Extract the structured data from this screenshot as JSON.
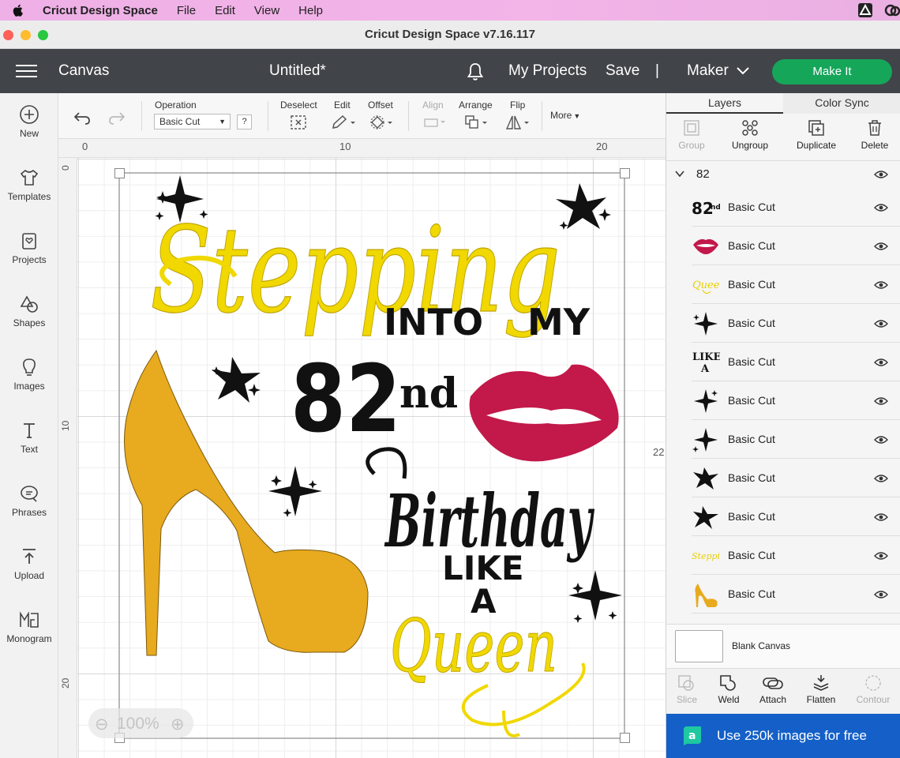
{
  "menubar": {
    "app_name": "Cricut Design Space",
    "menus": [
      "File",
      "Edit",
      "View",
      "Help"
    ]
  },
  "window": {
    "title": "Cricut Design Space  v7.16.117"
  },
  "header": {
    "canvas_label": "Canvas",
    "doc_title": "Untitled*",
    "my_projects": "My Projects",
    "save": "Save",
    "separator": "|",
    "machine": "Maker",
    "make_it": "Make It"
  },
  "left_tools": [
    {
      "label": "New",
      "icon": "plus-circle-icon"
    },
    {
      "label": "Templates",
      "icon": "shirt-icon"
    },
    {
      "label": "Projects",
      "icon": "projects-icon"
    },
    {
      "label": "Shapes",
      "icon": "shapes-icon"
    },
    {
      "label": "Images",
      "icon": "lightbulb-icon"
    },
    {
      "label": "Text",
      "icon": "text-icon"
    },
    {
      "label": "Phrases",
      "icon": "speech-bubble-icon"
    },
    {
      "label": "Upload",
      "icon": "upload-icon"
    },
    {
      "label": "Monogram",
      "icon": "monogram-icon"
    }
  ],
  "toolbar": {
    "operation_label": "Operation",
    "operation_value": "Basic Cut",
    "help": "?",
    "deselect": "Deselect",
    "edit": "Edit",
    "offset": "Offset",
    "align": "Align",
    "arrange": "Arrange",
    "flip": "Flip",
    "more": "More"
  },
  "rulers": {
    "top": [
      "0",
      "10",
      "20"
    ],
    "left": [
      "0",
      "10",
      "20"
    ],
    "size_label": "22"
  },
  "zoom": {
    "value": "100%"
  },
  "design": {
    "word_stepping": "Stepping",
    "word_into": "INTO",
    "word_my": "MY",
    "number": "82",
    "suffix": "nd",
    "word_birthday": "Birthday",
    "word_like": "LIKE",
    "word_a": "A",
    "word_queen": "Queen"
  },
  "panel": {
    "tabs": [
      "Layers",
      "Color Sync"
    ],
    "actions": [
      {
        "label": "Group",
        "enabled": false
      },
      {
        "label": "Ungroup",
        "enabled": true
      },
      {
        "label": "Duplicate",
        "enabled": true
      },
      {
        "label": "Delete",
        "enabled": true
      }
    ],
    "group_name": "82",
    "layers": [
      {
        "name": "Basic Cut",
        "thumb": "82nd"
      },
      {
        "name": "Basic Cut",
        "thumb": "lips"
      },
      {
        "name": "Basic Cut",
        "thumb": "queen"
      },
      {
        "name": "Basic Cut",
        "thumb": "star"
      },
      {
        "name": "Basic Cut",
        "thumb": "LIKE A"
      },
      {
        "name": "Basic Cut",
        "thumb": "star"
      },
      {
        "name": "Basic Cut",
        "thumb": "star"
      },
      {
        "name": "Basic Cut",
        "thumb": "star"
      },
      {
        "name": "Basic Cut",
        "thumb": "star"
      },
      {
        "name": "Basic Cut",
        "thumb": "stepping"
      },
      {
        "name": "Basic Cut",
        "thumb": "shoe"
      }
    ],
    "blank_canvas": "Blank Canvas",
    "bottom_actions": [
      {
        "label": "Slice",
        "enabled": false
      },
      {
        "label": "Weld",
        "enabled": true
      },
      {
        "label": "Attach",
        "enabled": true
      },
      {
        "label": "Flatten",
        "enabled": true
      },
      {
        "label": "Contour",
        "enabled": false
      }
    ],
    "promo": "Use 250k images for free"
  },
  "colors": {
    "header_bg": "#414448",
    "make_it_green": "#16a65a",
    "design_yellow": "#f0d800",
    "shoe_gold": "#e8aa1e",
    "lips_red": "#c2184a",
    "promo_blue": "#1460c8"
  }
}
